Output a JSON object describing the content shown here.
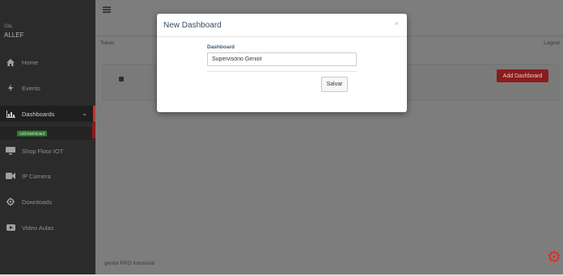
{
  "sidebar": {
    "greeting": "Olá,",
    "username": "ALLEF",
    "items": [
      {
        "label": "Home",
        "icon": "home-icon"
      },
      {
        "label": "Events",
        "icon": "bolt-icon"
      },
      {
        "label": "Dashboards",
        "icon": "bar-chart-icon"
      },
      {
        "label": "Shop Floor IOT",
        "icon": "monitor-icon"
      },
      {
        "label": "IP Camera",
        "icon": "video-camera-icon"
      },
      {
        "label": "Downloads",
        "icon": "settings-icon"
      },
      {
        "label": "Video Aulas",
        "icon": "play-icon"
      }
    ],
    "sub_item": "Add Dashboard"
  },
  "header": {
    "token_label": "Token",
    "logout_label": "Logout"
  },
  "main": {
    "add_dashboard_label": "Add Dashboard",
    "footer_text": "geniot PRO Industrial"
  },
  "modal": {
    "title": "New Dashboard",
    "close": "×",
    "field_label": "Dashboard",
    "field_value": "Supervisório Geniot",
    "save_label": "Salvar"
  },
  "colors": {
    "sidebar_bg": "#2b2b2b",
    "accent_red": "#c0392b",
    "gear": "#d93025",
    "badge_green": "#2e7d32"
  }
}
